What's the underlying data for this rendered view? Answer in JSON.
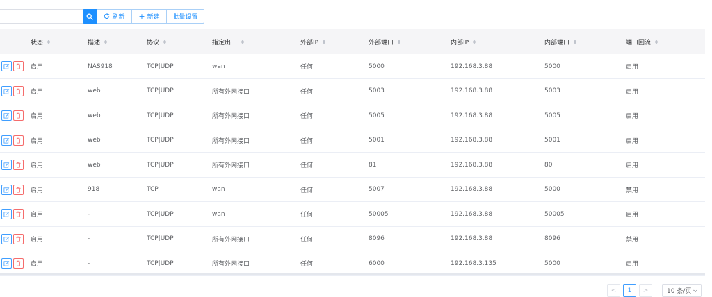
{
  "toolbar": {
    "search_placeholder": "",
    "search_icon": "search-icon",
    "refresh_label": "刷新",
    "new_label": "新建",
    "batch_label": "批量设置"
  },
  "table": {
    "columns": [
      "状态",
      "描述",
      "协议",
      "指定出口",
      "外部IP",
      "外部端口",
      "内部IP",
      "内部端口",
      "端口回流"
    ],
    "rows": [
      [
        "启用",
        "NAS918",
        "TCP|UDP",
        "wan",
        "任何",
        "5000",
        "192.168.3.88",
        "5000",
        "启用"
      ],
      [
        "启用",
        "web",
        "TCP|UDP",
        "所有外网接口",
        "任何",
        "5003",
        "192.168.3.88",
        "5003",
        "启用"
      ],
      [
        "启用",
        "web",
        "TCP|UDP",
        "所有外网接口",
        "任何",
        "5005",
        "192.168.3.88",
        "5005",
        "启用"
      ],
      [
        "启用",
        "web",
        "TCP|UDP",
        "所有外网接口",
        "任何",
        "5001",
        "192.168.3.88",
        "5001",
        "启用"
      ],
      [
        "启用",
        "web",
        "TCP|UDP",
        "所有外网接口",
        "任何",
        "81",
        "192.168.3.88",
        "80",
        "启用"
      ],
      [
        "启用",
        "918",
        "TCP",
        "wan",
        "任何",
        "5007",
        "192.168.3.88",
        "5000",
        "禁用"
      ],
      [
        "启用",
        "-",
        "TCP|UDP",
        "wan",
        "任何",
        "50005",
        "192.168.3.88",
        "50005",
        "启用"
      ],
      [
        "启用",
        "-",
        "TCP|UDP",
        "所有外网接口",
        "任何",
        "8096",
        "192.168.3.88",
        "8096",
        "禁用"
      ],
      [
        "启用",
        "-",
        "TCP|UDP",
        "所有外网接口",
        "任何",
        "6000",
        "192.168.3.135",
        "5000",
        "启用"
      ]
    ]
  },
  "pagination": {
    "prev": "<",
    "current_page": "1",
    "next": ">",
    "page_size": "10 条/页"
  },
  "colors": {
    "primary": "#1e90ff",
    "danger": "#f56c6c",
    "header_bg": "#f5f5f7"
  }
}
